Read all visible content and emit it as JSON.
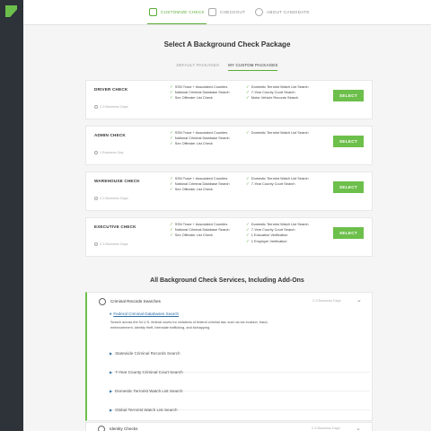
{
  "nav": {
    "steps": [
      {
        "label": "CUSTOMIZE CHECK",
        "icon": "customize-icon",
        "active": true
      },
      {
        "label": "CHECKOUT",
        "icon": "checkout-icon",
        "active": false
      },
      {
        "label": "ABOUT CANDIDATE",
        "icon": "user-icon",
        "active": false
      }
    ]
  },
  "page": {
    "title": "Select A Background Check Package",
    "tabs": [
      {
        "label": "DEFAULT PACKAGES",
        "active": false
      },
      {
        "label": "MY CUSTOM PACKAGES",
        "active": true
      }
    ]
  },
  "packages": [
    {
      "name": "DRIVER CHECK",
      "days": "2-3 Business Days",
      "col1": [
        "SSN Trace + Associated Counties",
        "National Criminal Database Search",
        "Sex Offender List Check"
      ],
      "col2": [
        "Domestic Terrorist Watch List Search",
        "7-Year County Court Search",
        "Motor Vehicle Records Search"
      ],
      "button": "SELECT"
    },
    {
      "name": "ADMIN CHECK",
      "days": "1 Business Day",
      "col1": [
        "SSN Trace + Associated Counties",
        "National Criminal Database Search",
        "Sex Offender List Check"
      ],
      "col2": [
        "Domestic Terrorist Watch List Search"
      ],
      "button": "SELECT"
    },
    {
      "name": "WAREHOUSE CHECK",
      "days": "2-3 Business Days",
      "col1": [
        "SSN Trace + Associated Counties",
        "National Criminal Database Search",
        "Sex Offender List Check"
      ],
      "col2": [
        "Domestic Terrorist Watch List Search",
        "7-Year County Court Search"
      ],
      "button": "SELECT"
    },
    {
      "name": "EXECUTIVE CHECK",
      "days": "2-3 Business Days",
      "col1": [
        "SSN Trace + Associated Counties",
        "National Criminal Database Search",
        "Sex Offender List Check"
      ],
      "col2": [
        "Domestic Terrorist Watch List Search",
        "7-Year County Court Search",
        "1 Education Verification",
        "1 Employer Verification"
      ],
      "button": "SELECT"
    }
  ],
  "services": {
    "title": "All Background Check Services, Including Add-Ons",
    "group": {
      "name": "Criminal Records Searches",
      "days": "2-3 Business Days",
      "expanded_item": "Federal Criminal Databases Search",
      "expanded_desc": "Search across the 94 U.S. federal courts for violations of federal criminal law, such as tax evasion, fraud, embezzlement, identity theft, interstate trafficking, and kidnapping.",
      "items": [
        "Statewide Criminal Records Search",
        "7-Year County Criminal Court Search",
        "Domestic Terrorist Watch List Search",
        "Global Terrorist Watch List Search"
      ]
    },
    "next_group": {
      "name": "Identity Checks",
      "days": "2-3 Business Days"
    }
  },
  "colors": {
    "accent": "#6dbf4b",
    "sidebar": "#2d3339",
    "link": "#2b6ea6"
  }
}
